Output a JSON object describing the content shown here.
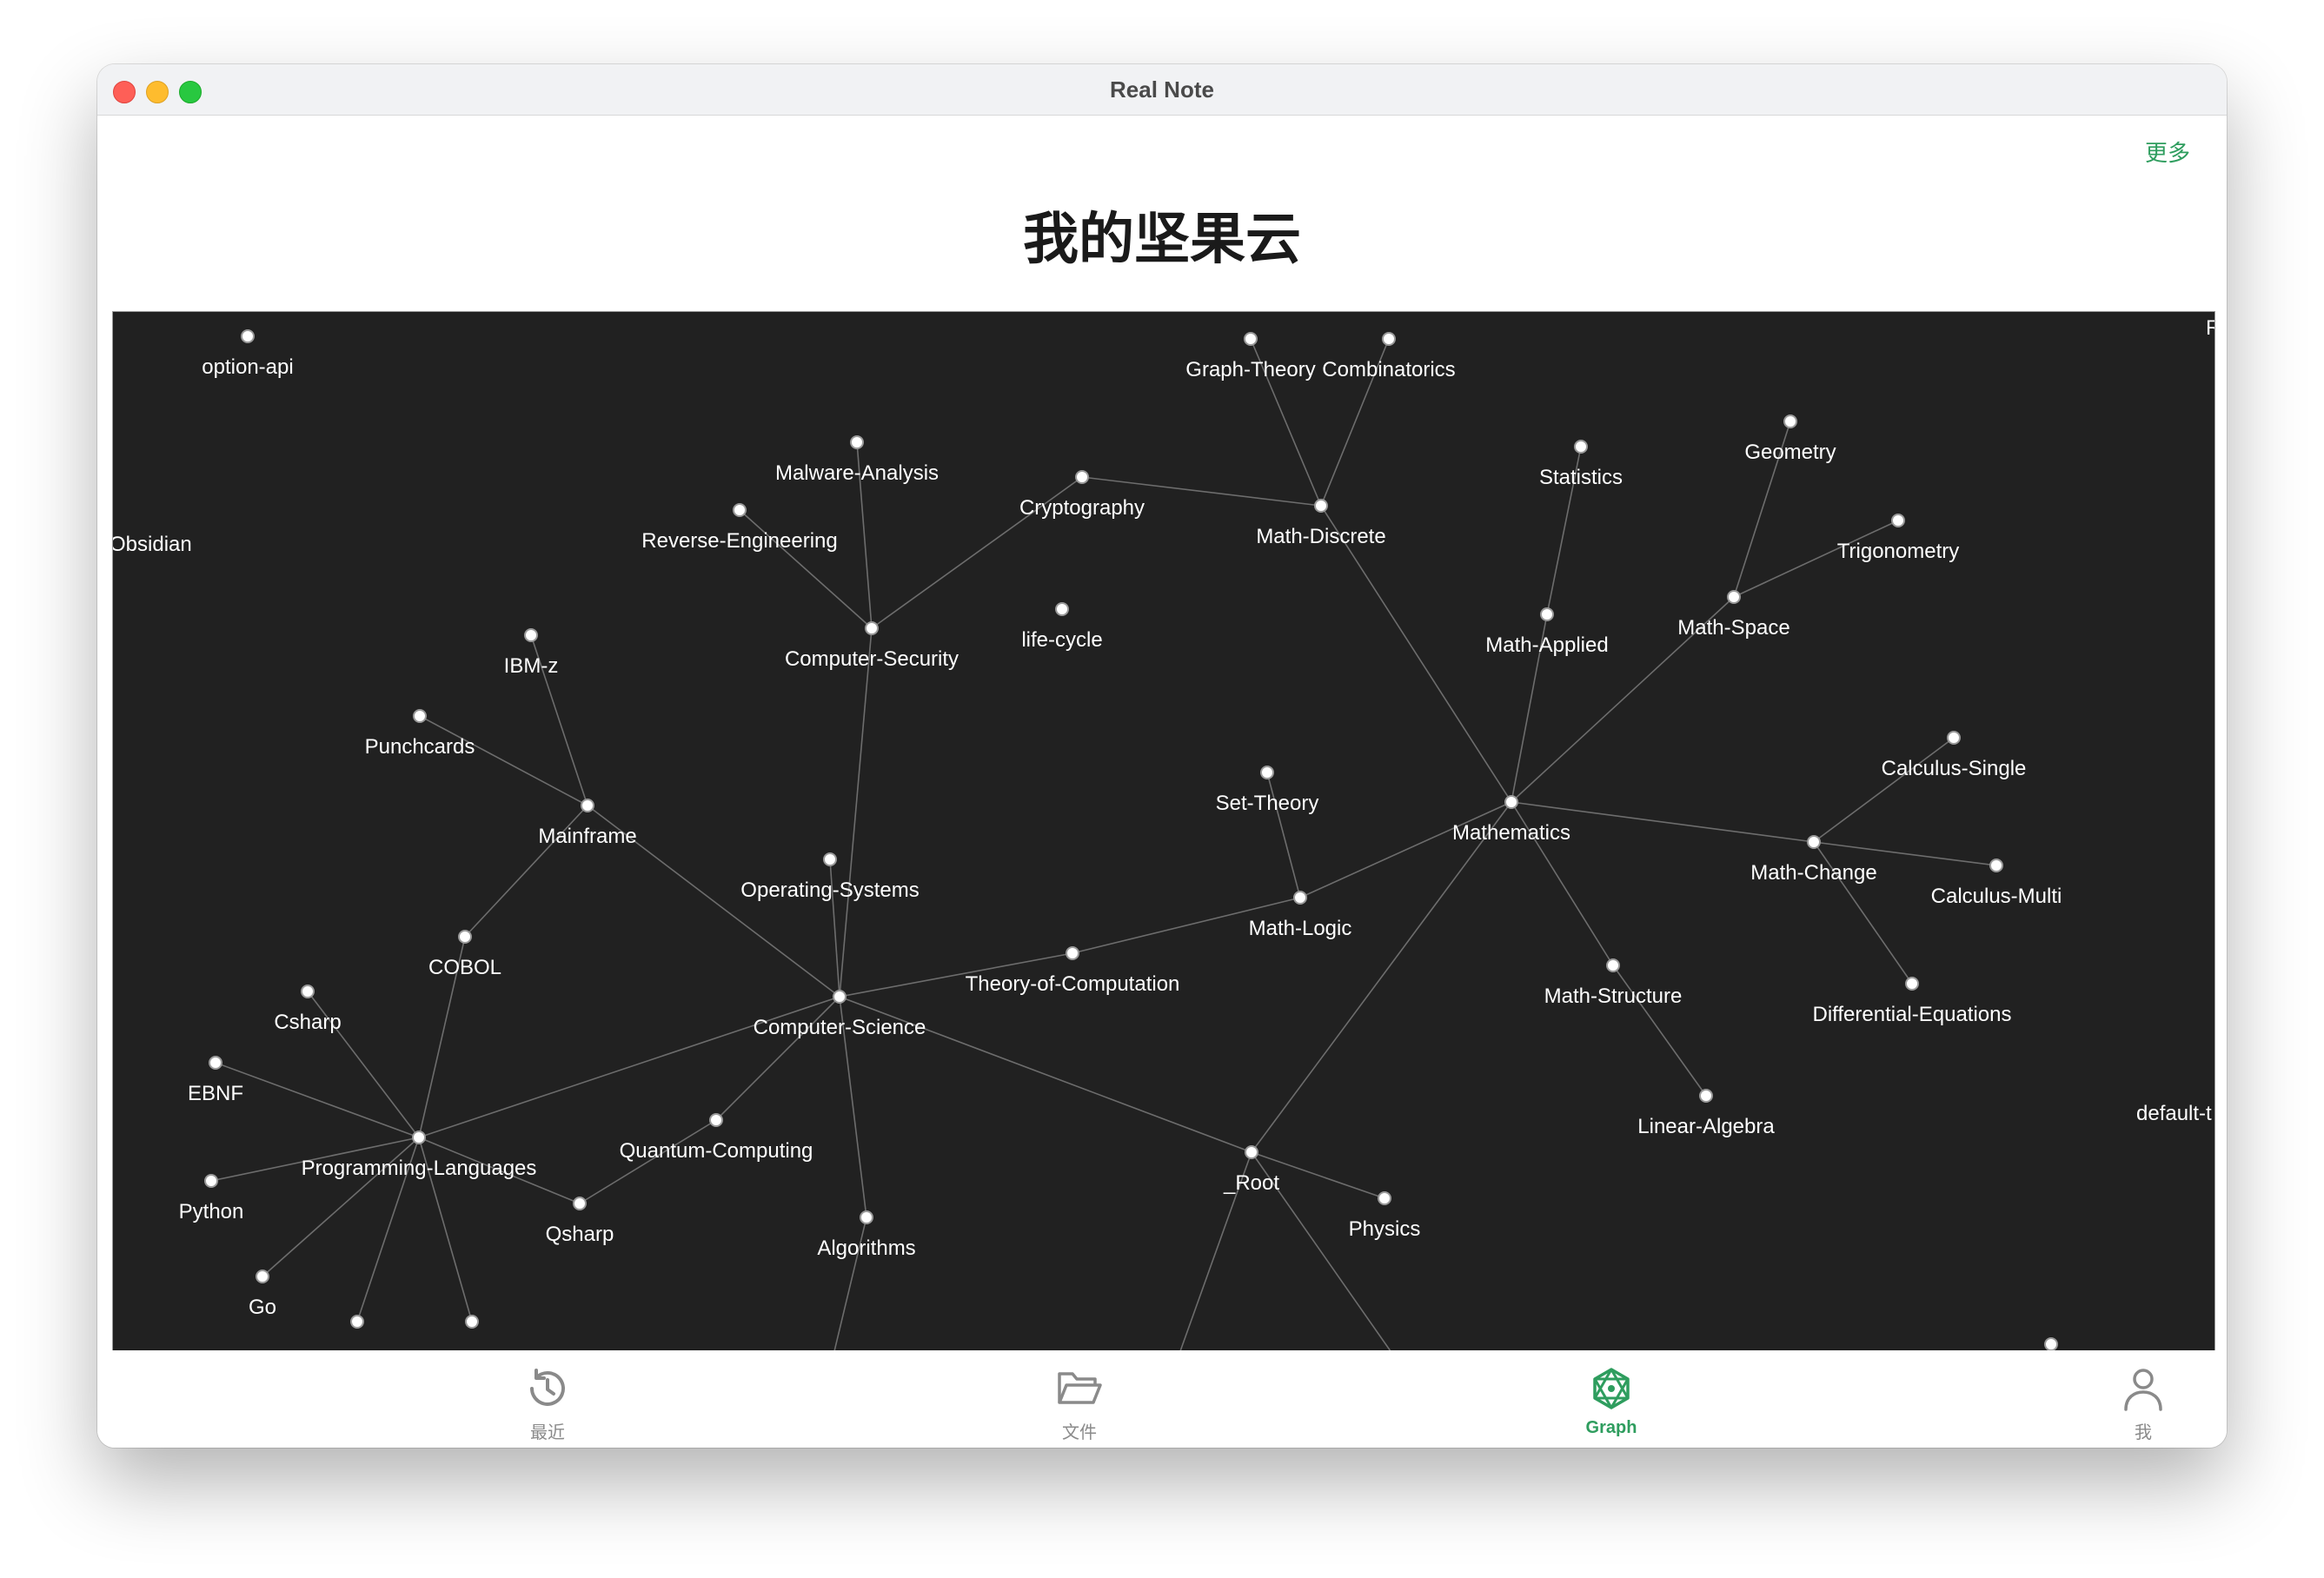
{
  "window": {
    "title": "Real Note"
  },
  "header": {
    "more_label": "更多",
    "page_title": "我的坚果云"
  },
  "graph": {
    "nodes": [
      {
        "id": "option-api",
        "label": "option-api"
      },
      {
        "id": "Graph-Theory",
        "label": "Graph-Theory"
      },
      {
        "id": "Combinatorics",
        "label": "Combinatorics"
      },
      {
        "id": "README",
        "label": "READM"
      },
      {
        "id": "Malware-Analysis",
        "label": "Malware-Analysis"
      },
      {
        "id": "Reverse-Engineering",
        "label": "Reverse-Engineering"
      },
      {
        "id": "Cryptography",
        "label": "Cryptography"
      },
      {
        "id": "Math-Discrete",
        "label": "Math-Discrete"
      },
      {
        "id": "Statistics",
        "label": "Statistics"
      },
      {
        "id": "Geometry",
        "label": "Geometry"
      },
      {
        "id": "Trigonometry",
        "label": "Trigonometry"
      },
      {
        "id": "Obsidian",
        "label": "Obsidian"
      },
      {
        "id": "Computer-Security",
        "label": "Computer-Security"
      },
      {
        "id": "life-cycle",
        "label": "life-cycle"
      },
      {
        "id": "Math-Applied",
        "label": "Math-Applied"
      },
      {
        "id": "Math-Space",
        "label": "Math-Space"
      },
      {
        "id": "IBM-z",
        "label": "IBM-z"
      },
      {
        "id": "Punchcards",
        "label": "Punchcards"
      },
      {
        "id": "Calculus-Single",
        "label": "Calculus-Single"
      },
      {
        "id": "Set-Theory",
        "label": "Set-Theory"
      },
      {
        "id": "Mathematics",
        "label": "Mathematics"
      },
      {
        "id": "Mainframe",
        "label": "Mainframe"
      },
      {
        "id": "Operating-Systems",
        "label": "Operating-Systems"
      },
      {
        "id": "Math-Change",
        "label": "Math-Change"
      },
      {
        "id": "Calculus-Multi",
        "label": "Calculus-Multi"
      },
      {
        "id": "Math-Logic",
        "label": "Math-Logic"
      },
      {
        "id": "COBOL",
        "label": "COBOL"
      },
      {
        "id": "Theory-of-Computation",
        "label": "Theory-of-Computation"
      },
      {
        "id": "Math-Structure",
        "label": "Math-Structure"
      },
      {
        "id": "Differential-Equations",
        "label": "Differential-Equations"
      },
      {
        "id": "Csharp",
        "label": "Csharp"
      },
      {
        "id": "Computer-Science",
        "label": "Computer-Science"
      },
      {
        "id": "EBNF",
        "label": "EBNF"
      },
      {
        "id": "Linear-Algebra",
        "label": "Linear-Algebra"
      },
      {
        "id": "default-t",
        "label": "default-t"
      },
      {
        "id": "Quantum-Computing",
        "label": "Quantum-Computing"
      },
      {
        "id": "Programming-Languages",
        "label": "Programming-Languages"
      },
      {
        "id": "_Root",
        "label": "_Root"
      },
      {
        "id": "Python",
        "label": "Python"
      },
      {
        "id": "Physics",
        "label": "Physics"
      },
      {
        "id": "Qsharp",
        "label": "Qsharp"
      },
      {
        "id": "Algorithms",
        "label": "Algorithms"
      },
      {
        "id": "Go",
        "label": "Go"
      },
      {
        "id": "bottom-a",
        "label": ""
      },
      {
        "id": "bottom-b",
        "label": ""
      },
      {
        "id": "bottom-c",
        "label": ""
      }
    ],
    "edges": [
      [
        "Graph-Theory",
        "Math-Discrete"
      ],
      [
        "Combinatorics",
        "Math-Discrete"
      ],
      [
        "Cryptography",
        "Math-Discrete"
      ],
      [
        "Cryptography",
        "Computer-Security"
      ],
      [
        "Malware-Analysis",
        "Computer-Security"
      ],
      [
        "Reverse-Engineering",
        "Computer-Security"
      ],
      [
        "Computer-Security",
        "Computer-Science"
      ],
      [
        "Math-Discrete",
        "Mathematics"
      ],
      [
        "Statistics",
        "Math-Applied"
      ],
      [
        "Math-Applied",
        "Mathematics"
      ],
      [
        "Geometry",
        "Math-Space"
      ],
      [
        "Trigonometry",
        "Math-Space"
      ],
      [
        "Math-Space",
        "Mathematics"
      ],
      [
        "Mathematics",
        "Math-Change"
      ],
      [
        "Calculus-Single",
        "Math-Change"
      ],
      [
        "Calculus-Multi",
        "Math-Change"
      ],
      [
        "Differential-Equations",
        "Math-Change"
      ],
      [
        "Mathematics",
        "Math-Logic"
      ],
      [
        "Set-Theory",
        "Math-Logic"
      ],
      [
        "Math-Logic",
        "Theory-of-Computation"
      ],
      [
        "Theory-of-Computation",
        "Computer-Science"
      ],
      [
        "Mathematics",
        "Math-Structure"
      ],
      [
        "Math-Structure",
        "Linear-Algebra"
      ],
      [
        "Mathematics",
        "_Root"
      ],
      [
        "IBM-z",
        "Mainframe"
      ],
      [
        "Punchcards",
        "Mainframe"
      ],
      [
        "Mainframe",
        "COBOL"
      ],
      [
        "Mainframe",
        "Computer-Science"
      ],
      [
        "Operating-Systems",
        "Computer-Science"
      ],
      [
        "COBOL",
        "Programming-Languages"
      ],
      [
        "Csharp",
        "Programming-Languages"
      ],
      [
        "EBNF",
        "Programming-Languages"
      ],
      [
        "Python",
        "Programming-Languages"
      ],
      [
        "Go",
        "Programming-Languages"
      ],
      [
        "Qsharp",
        "Programming-Languages"
      ],
      [
        "Qsharp",
        "Quantum-Computing"
      ],
      [
        "Quantum-Computing",
        "Computer-Science"
      ],
      [
        "Programming-Languages",
        "Computer-Science"
      ],
      [
        "Computer-Science",
        "_Root"
      ],
      [
        "Computer-Science",
        "Algorithms"
      ],
      [
        "_Root",
        "Physics"
      ],
      [
        "Programming-Languages",
        "bottom-a"
      ],
      [
        "Programming-Languages",
        "bottom-b"
      ]
    ],
    "colors": {
      "background": "#212121",
      "edge": "#6d6d6d",
      "node": "#ffffff",
      "label": "#ffffff"
    }
  },
  "tabs": [
    {
      "id": "recent",
      "label": "最近",
      "icon": "history-clock-icon",
      "active": false
    },
    {
      "id": "files",
      "label": "文件",
      "icon": "folder-open-icon",
      "active": false
    },
    {
      "id": "graph",
      "label": "Graph",
      "icon": "graph-network-icon",
      "active": true
    },
    {
      "id": "me",
      "label": "我",
      "icon": "person-icon",
      "active": false
    }
  ],
  "accent_color": "#2e9d5e"
}
